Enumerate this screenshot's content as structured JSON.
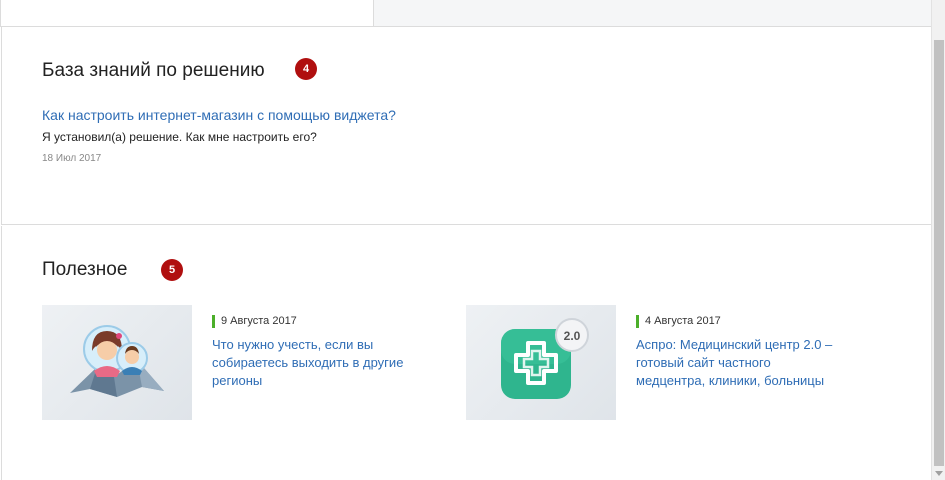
{
  "knowledge_base": {
    "title": "База знаний по решению",
    "badge": "4",
    "article": {
      "title": "Как настроить интернет-магазин с помощью виджета?",
      "description": "Я установил(а) решение. Как мне настроить его?",
      "date": "18 Июл 2017"
    }
  },
  "useful": {
    "title": "Полезное",
    "badge": "5",
    "items": [
      {
        "date": "9 Августа 2017",
        "title": "Что нужно учесть, если вы собираетесь выходить в другие регионы",
        "image_icon": "people-map-illustration-icon"
      },
      {
        "date": "4 Августа 2017",
        "title": "Аспро: Медицинский центр 2.0 – готовый сайт частного медцентра, клиники, больницы",
        "image_icon": "medical-cross-app-icon",
        "version_badge": "2.0"
      }
    ]
  },
  "colors": {
    "link": "#2f6db5",
    "badge": "#b00f0f",
    "date_accent": "#4caf2a",
    "app_green": "#2fb58e"
  }
}
